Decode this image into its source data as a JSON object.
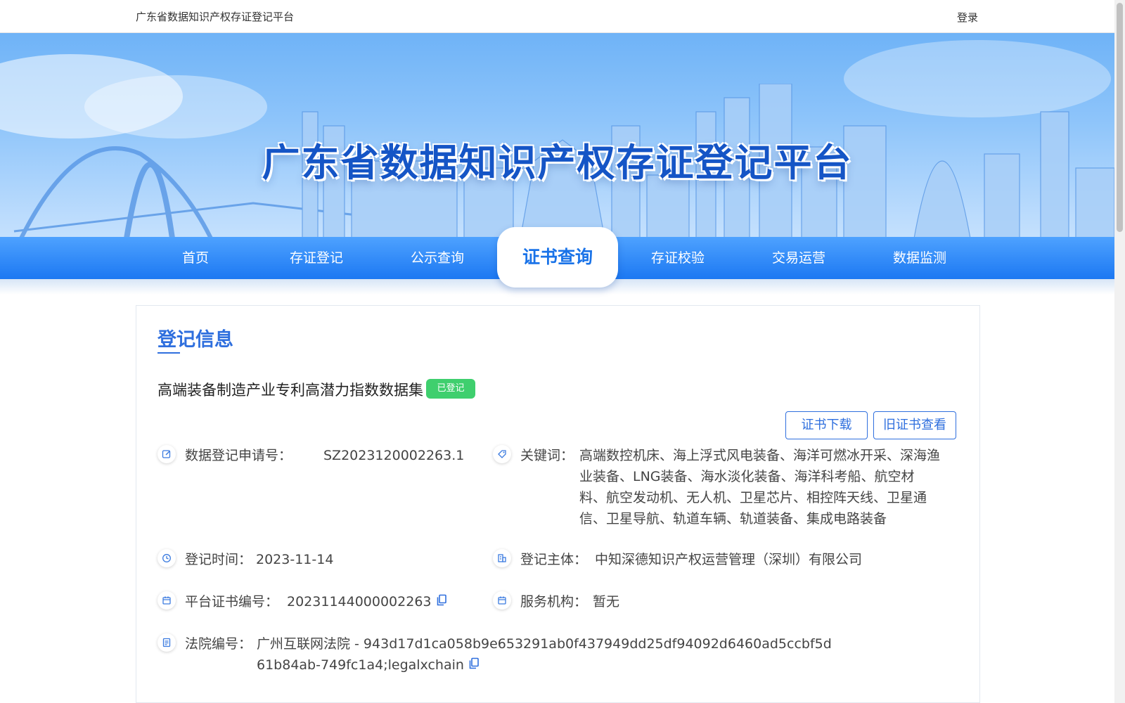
{
  "topbar": {
    "site_name": "广东省数据知识产权存证登记平台",
    "login": "登录"
  },
  "banner": {
    "title": "广东省数据知识产权存证登记平台"
  },
  "nav": {
    "items": [
      {
        "label": "首页",
        "active": false
      },
      {
        "label": "存证登记",
        "active": false
      },
      {
        "label": "公示查询",
        "active": false
      },
      {
        "label": "证书查询",
        "active": true
      },
      {
        "label": "存证校验",
        "active": false
      },
      {
        "label": "交易运营",
        "active": false
      },
      {
        "label": "数据监测",
        "active": false
      }
    ]
  },
  "registration": {
    "section_title": "登记信息",
    "dataset_name": "高端装备制造产业专利高潜力指数数据集",
    "status": "已登记",
    "buttons": {
      "download": "证书下载",
      "old_cert": "旧证书查看"
    },
    "fields": {
      "application_no": {
        "label": "数据登记申请号：",
        "value": "SZ2023120002263.1",
        "icon": "edit-icon"
      },
      "keywords": {
        "label": "关键词：",
        "value": "高端数控机床、海上浮式风电装备、海洋可燃冰开采、深海渔业装备、LNG装备、海水淡化装备、海洋科考船、航空材料、航空发动机、无人机、卫星芯片、相控阵天线、卫星通信、卫星导航、轨道车辆、轨道装备、集成电路装备",
        "icon": "tag-icon"
      },
      "reg_time": {
        "label": "登记时间：",
        "value": "2023-11-14",
        "icon": "clock-icon"
      },
      "reg_subject": {
        "label": "登记主体：",
        "value": "中知深德知识产权运营管理（深圳）有限公司",
        "icon": "building-icon"
      },
      "cert_no": {
        "label": "平台证书编号：",
        "value": "20231144000002263",
        "icon": "calendar-icon"
      },
      "service_org": {
        "label": "服务机构：",
        "value": "暂无",
        "icon": "calendar-icon"
      },
      "court_no": {
        "label": "法院编号：",
        "value": "广州互联网法院 - 943d17d1ca058b9e653291ab0f437949dd25df94092d6460ad5ccbf5d61b84ab-749fc1a4;legalxchain",
        "icon": "document-icon"
      }
    }
  },
  "colors": {
    "primary": "#2f6fde",
    "nav_gradient_top": "#4ea2ff",
    "nav_gradient_bottom": "#1c78f2",
    "badge_green": "#3fcf6e"
  }
}
